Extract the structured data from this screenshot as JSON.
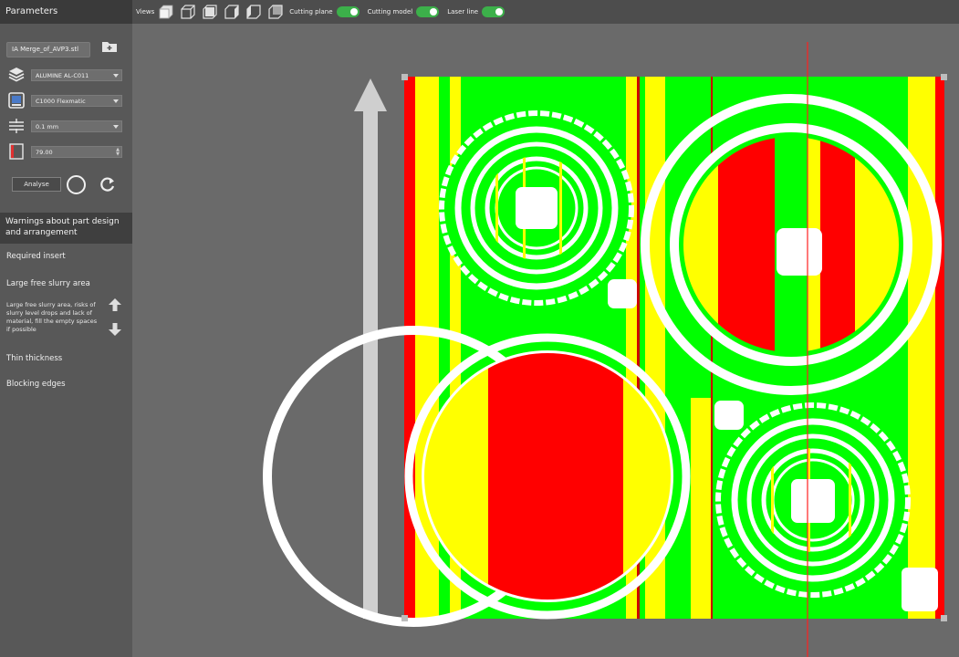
{
  "sidebar": {
    "header": "Parameters",
    "file_name": "IA Merge_of_AVP3.stl",
    "material": "ALUMINE AL-C011",
    "machine": "C1000 Flexmatic",
    "layer": "0.1 mm",
    "value": "79.00",
    "analyse_label": "Analyse"
  },
  "warnings": {
    "header": "Warnings about part design and arrangement",
    "required_insert": "Required insert",
    "large_free_slurry": "Large free slurry area",
    "large_free_slurry_desc": "Large free slurry area, risks of slurry level drops and lack of material, fill the empty spaces if possible",
    "thin_thickness": "Thin thickness",
    "blocking_edges": "Blocking edges"
  },
  "topbar": {
    "views_label": "Views",
    "cutting_plane_label": "Cutting plane",
    "cutting_model_label": "Cutting model",
    "laser_line_label": "Laser line",
    "cutting_plane_on": true,
    "cutting_model_on": true,
    "laser_line_on": true
  },
  "colors": {
    "green": "#00ff00",
    "yellow": "#ffff00",
    "red": "#ff0000",
    "laser": "#ff2020",
    "toggle_on": "#3cb04a"
  },
  "icons": {
    "folder": "folder-add-icon",
    "material": "layers-icon",
    "machine": "printer-icon",
    "layer": "layer-thickness-icon",
    "value": "dimension-icon",
    "reload": "refresh-icon",
    "up": "arrow-up-icon",
    "down": "arrow-down-icon"
  }
}
